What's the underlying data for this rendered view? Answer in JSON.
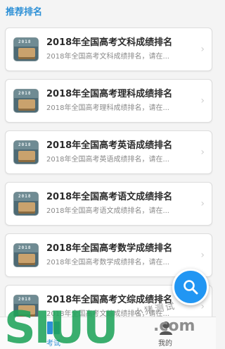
{
  "section": {
    "title": "推荐排名"
  },
  "cards": [
    {
      "title": "2018年全国高考文科成绩排名",
      "desc": "2018年全国高考文科成绩排名，请在..."
    },
    {
      "title": "2018年全国高考理科成绩排名",
      "desc": "2018年全国高考理科成绩排名，请在..."
    },
    {
      "title": "2018年全国高考英语成绩排名",
      "desc": "2018年全国高考英语成绩排名，请在..."
    },
    {
      "title": "2018年全国高考语文成绩排名",
      "desc": "2018年全国高考语文成绩排名，请在..."
    },
    {
      "title": "2018年全国高考数学成绩排名",
      "desc": "2018年全国高考数学成绩排名，请在..."
    },
    {
      "title": "2018年全国高考文综成绩排名",
      "desc": "2018年全国高考文综成绩排名，请在..."
    }
  ],
  "card_icon": {
    "year": "2018",
    "name": "book-cover-thumbnail"
  },
  "chevron": "›",
  "fab": {
    "icon": "search-icon"
  },
  "tabbar": {
    "tabs": [
      {
        "label": "考试",
        "icon": "exam-icon",
        "active": true
      },
      {
        "label": "我的",
        "icon": "person-icon",
        "active": false
      }
    ]
  },
  "watermark": {
    "logo": "SIUU",
    "text": "小猪测试",
    "suffix": ".com"
  },
  "colors": {
    "accent": "#2b8fd6",
    "fab": "#2196f3",
    "watermark_green": "#1fa35a"
  }
}
